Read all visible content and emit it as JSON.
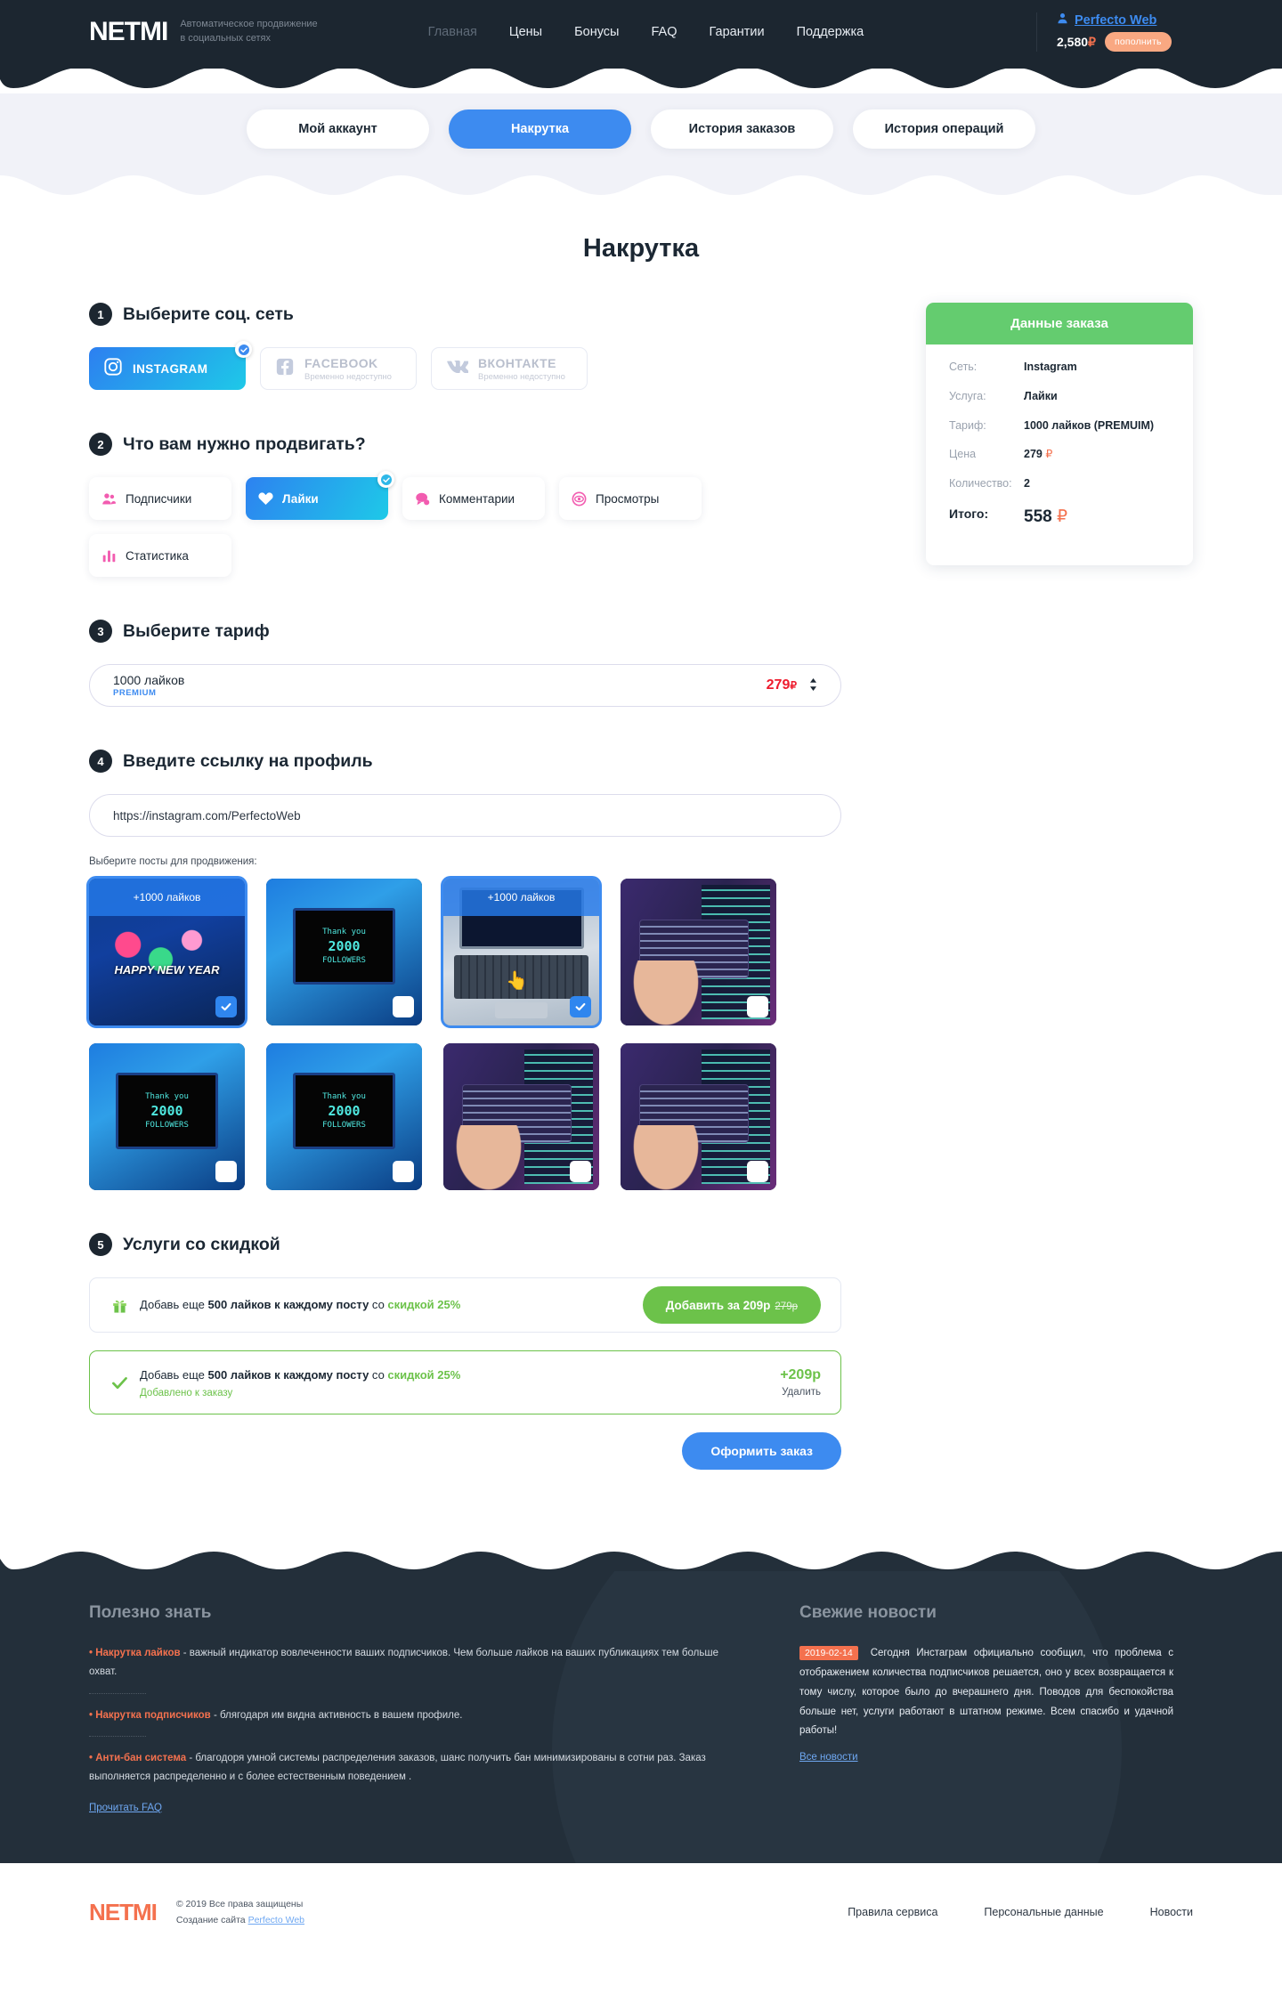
{
  "header": {
    "logo": "NETMI",
    "tagline_line1": "Автоматическое продвижение",
    "tagline_line2": "в социальных сетях",
    "nav": [
      {
        "label": "Главная",
        "muted": true
      },
      {
        "label": "Цены",
        "muted": false
      },
      {
        "label": "Бонусы",
        "muted": false
      },
      {
        "label": "FAQ",
        "muted": false
      },
      {
        "label": "Гарантии",
        "muted": false
      },
      {
        "label": "Поддержка",
        "muted": false
      }
    ],
    "account_name": "Perfecto Web",
    "balance": "2,580",
    "currency": "₽",
    "topup_label": "пополнить"
  },
  "tabs": [
    {
      "label": "Мой аккаунт",
      "active": false
    },
    {
      "label": "Накрутка",
      "active": true
    },
    {
      "label": "История заказов",
      "active": false
    },
    {
      "label": "История операций",
      "active": false
    }
  ],
  "page_title": "Накрутка",
  "steps": {
    "s1": {
      "num": "1",
      "title": "Выберите соц. сеть"
    },
    "s2": {
      "num": "2",
      "title": "Что вам нужно продвигать?"
    },
    "s3": {
      "num": "3",
      "title": "Выберите тариф"
    },
    "s4": {
      "num": "4",
      "title": "Введите ссылку на профиль"
    },
    "s5": {
      "num": "5",
      "title": "Услуги со скидкой"
    }
  },
  "socials": [
    {
      "label": "INSTAGRAM",
      "sub": "",
      "selected": true,
      "icon": "instagram-icon"
    },
    {
      "label": "FACEBOOK",
      "sub": "Временно недоступно",
      "selected": false,
      "icon": "facebook-icon"
    },
    {
      "label": "ВКОНТАКТЕ",
      "sub": "Временно недоступно",
      "selected": false,
      "icon": "vk-icon"
    }
  ],
  "services": [
    {
      "label": "Подписчики",
      "selected": false,
      "icon": "followers-icon"
    },
    {
      "label": "Лайки",
      "selected": true,
      "icon": "heart-icon"
    },
    {
      "label": "Комментарии",
      "selected": false,
      "icon": "comment-icon"
    },
    {
      "label": "Просмотры",
      "selected": false,
      "icon": "eye-icon"
    },
    {
      "label": "Статистика",
      "selected": false,
      "icon": "chart-icon"
    }
  ],
  "summary": {
    "title": "Данные заказа",
    "rows": [
      {
        "key": "Сеть:",
        "value": "Instagram",
        "rub": ""
      },
      {
        "key": "Услуга:",
        "value": "Лайки",
        "rub": ""
      },
      {
        "key": "Тариф:",
        "value": "1000 лайков (PREMUIM)",
        "rub": ""
      },
      {
        "key": "Цена",
        "value": "279",
        "rub": "₽"
      },
      {
        "key": "Количество:",
        "value": "2",
        "rub": ""
      }
    ],
    "total_key": "Итого:",
    "total_value": "558",
    "total_rub": "₽"
  },
  "tariff": {
    "name": "1000 лайков",
    "badge": "PREMIUM",
    "price": "279",
    "rub": "₽"
  },
  "profile": {
    "url_value": "https://instagram.com/PerfectoWeb",
    "url_placeholder": "https://instagram.com/",
    "posts_hint": "Выберите посты для продвижения:"
  },
  "posts": [
    {
      "banner": "+1000 лайков",
      "selected": true,
      "thumb": "new-year-lights"
    },
    {
      "banner": "",
      "selected": false,
      "thumb": "oled-thank-you"
    },
    {
      "banner": "+1000 лайков",
      "selected": true,
      "thumb": "laptop-code"
    },
    {
      "banner": "",
      "selected": false,
      "thumb": "hand-code"
    },
    {
      "banner": "",
      "selected": false,
      "thumb": "oled-thank-you"
    },
    {
      "banner": "",
      "selected": false,
      "thumb": "oled-thank-you"
    },
    {
      "banner": "",
      "selected": false,
      "thumb": "hand-code"
    },
    {
      "banner": "",
      "selected": false,
      "thumb": "hand-code"
    }
  ],
  "post_thumb_text": {
    "oled_line1": "Thank you",
    "oled_line2": "2000",
    "oled_line3": "FOLLOWERS"
  },
  "discounts": {
    "offer": {
      "text_a": "Добавь еще ",
      "text_b": "500 лайков к каждому посту",
      "text_c": " со ",
      "text_d": "скидкой 25%",
      "button": "Добавить за 209р",
      "old_price": "279р"
    },
    "added": {
      "text_a": "Добавь еще ",
      "text_b": "500 лайков к каждому посту",
      "text_c": " со ",
      "text_d": "скидкой 25%",
      "status": "Добавлено к заказу",
      "amount": "+209р",
      "remove": "Удалить"
    }
  },
  "submit_label": "Оформить заказ",
  "footer": {
    "left_title": "Полезно знать",
    "items": [
      {
        "accent": "• Накрутка лайков",
        "text": " - важный индикатор вовлеченности  ваших подписчиков. Чем больше лайков на ваших публикациях тем больше охват."
      },
      {
        "accent": "• Накрутка подписчиков",
        "text": " - блягодаря им видна активность в вашем профиле."
      },
      {
        "accent": "• Анти-бан система",
        "text": " - благодоря умной системы распределения заказов, шанс получить бан минимизированы в сотни раз. Заказ выполняется распределенно и с более естественным поведением ."
      }
    ],
    "faq_link": "Прочитать FAQ",
    "right_title": "Свежие новости",
    "news_date": "2019-02-14",
    "news_text": "Сегодня Инстаграм официально сообщил, что проблема с отображением количества подписчиков решается, оно у всех возвращается к тому числу, которое было до вчерашнего дня. Поводов для беспокойства больше нет, услуги работают в штатном режиме. Всем спасибо и удачной работы!",
    "news_link": "Все новости"
  },
  "bottom": {
    "logo": "NETMI",
    "copyright": "© 2019 Все права защищены",
    "made_by_prefix": "Создание сайта ",
    "made_by": "Perfecto Web",
    "links": [
      "Правила сервиса",
      "Персональные данные",
      "Новости"
    ]
  },
  "colors": {
    "dark": "#1c2630",
    "accent_blue": "#3d8bf0",
    "accent_orange": "#f4714e",
    "green": "#6cc24a",
    "summary_green": "#64cc6f",
    "red": "#ee1c2e",
    "band": "#f1f2f8"
  }
}
